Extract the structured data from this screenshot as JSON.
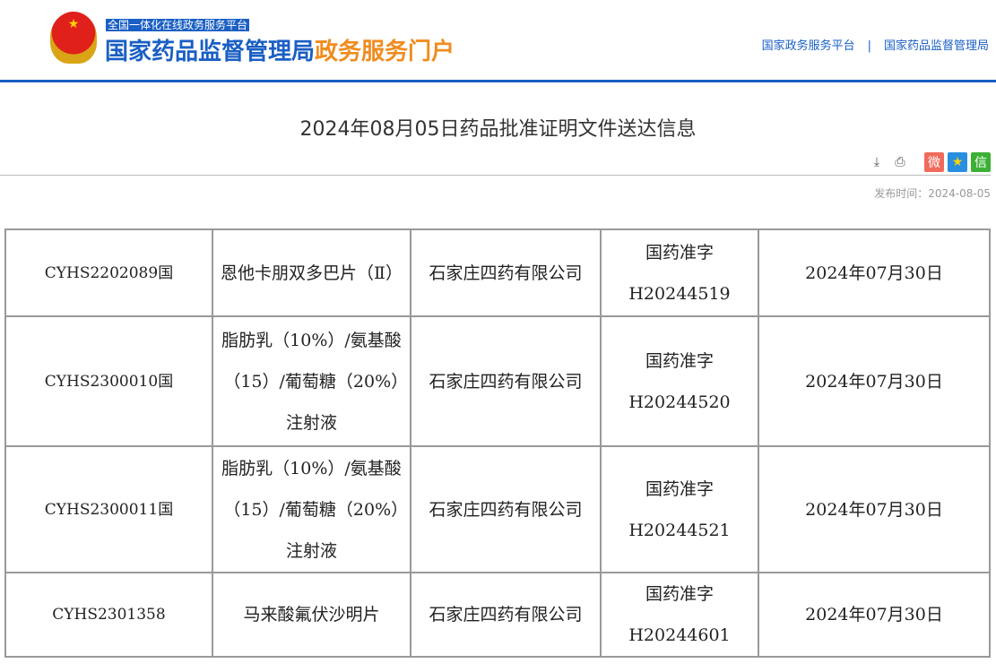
{
  "header": {
    "platform": "全国一体化在线政务服务平台",
    "brand_main": "国家药品监督管理局",
    "brand_accent": "政务服务门户",
    "links": [
      "国家政务服务平台",
      "国家药品监督管理局"
    ],
    "separator": "|",
    "emblem_star": "★"
  },
  "page": {
    "title": "2024年08月05日药品批准证明文件送达信息",
    "publish_label": "发布时间：",
    "publish_date": "2024-08-05"
  },
  "tools": {
    "download": "⤓",
    "print": "⎙",
    "weibo": "微",
    "qzone": "★",
    "wechat": "信"
  },
  "colors": {
    "brand": "#1a5fc4",
    "accent": "#f08c1e",
    "weibo": "#f06a5a",
    "qzone": "#2a8ee0",
    "wechat": "#3cb034"
  },
  "rows": [
    {
      "code": "CYHS2202089国",
      "name": "恩他卡朋双多巴片（Ⅱ）",
      "company": "石家庄四药有限公司",
      "approval": "国药准字H20244519",
      "date": "2024年07月30日"
    },
    {
      "code": "CYHS2300010国",
      "name": "脂肪乳（10%）/氨基酸（15）/葡萄糖（20%）注射液",
      "company": "石家庄四药有限公司",
      "approval": "国药准字H20244520",
      "date": "2024年07月30日"
    },
    {
      "code": "CYHS2300011国",
      "name": "脂肪乳（10%）/氨基酸（15）/葡萄糖（20%）注射液",
      "company": "石家庄四药有限公司",
      "approval": "国药准字H20244521",
      "date": "2024年07月30日"
    },
    {
      "code": "CYHS2301358",
      "name": "马来酸氟伏沙明片",
      "company": "石家庄四药有限公司",
      "approval": "国药准字H20244601",
      "date": "2024年07月30日"
    }
  ]
}
